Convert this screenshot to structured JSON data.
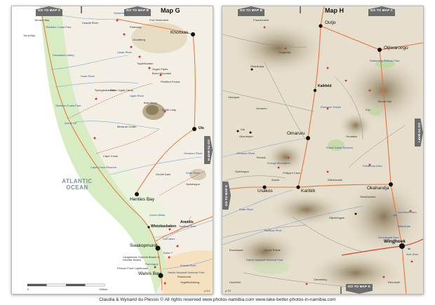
{
  "footer_text": "Claudia & Wynand du Plessis  ©  All rights reserved   www.photos-namibia.com   www.take-better-photos-in-namibia.com",
  "map_g": {
    "title": "Map G",
    "nav": {
      "top_left": "GO TO MAP A",
      "top_right": "GO TO MAP B",
      "right": "GO TO MAP H"
    },
    "ocean": "ATLANTIC OCEAN",
    "scale": {
      "start": "0",
      "end": "100km"
    },
    "page_number": "p.14",
    "labels_blue": [
      "Sesfontein",
      "Skeleton Coast Park",
      "Desolation Valley",
      "Huab River",
      "Uniab River",
      "Skeleton Coast Park",
      "Ugab River",
      "Cape Cross Reserve",
      "Dorob NP",
      "Omaruru River",
      "Khan River",
      "Swakop River",
      "Kuiseb River",
      "Namib Naukluft National Park",
      "Lichen fields",
      "Salt lakes",
      "Flamingos"
    ],
    "labels_black": [
      "Torra Bay",
      "Terrace Bay",
      "Springbokwasser",
      "Palmwag",
      "Grootberg",
      "Fort Sesfontein",
      "Hoanib River",
      "Rhino Ugab Camp",
      "Brandberg",
      "White Lady",
      "Messum Crater",
      "Uis",
      "Cape Cross",
      "Omdel Dam",
      "Spitzkoppe",
      "Langstrand, Dolphin Beach & Afrodite Beach",
      "Pelican Point Lighthouse",
      "Dune 7",
      "Vogelfederberg",
      "Rossmund"
    ],
    "towns": [
      "Khorixas",
      "Henties Bay",
      "Swakopmund",
      "Walvis Bay",
      "Wlotzkasbaken",
      "Arandis",
      "Twyfelfontein",
      "Organ Pipes",
      "Burnt Mountain",
      "Petrified Forest"
    ]
  },
  "map_h": {
    "title": "Map H",
    "nav": {
      "top_left": "GO TO MAP B",
      "top_right": "GO TO MAP C",
      "left": "GO TO MAP G",
      "right": "GO TO MAP I",
      "bottom": "GO TO MAP K"
    },
    "page_number": "p.15",
    "towns": [
      "Outjo",
      "Otjiwarongo",
      "Kalkfeld",
      "Omaruru",
      "Karibib",
      "Usakos",
      "Okahandja",
      "Windhoek"
    ],
    "labels_blue": [
      "Waterberg Plateau Park",
      "Etjo",
      "Omaruru River",
      "Khan River",
      "Swakop River",
      "Von Bach Dam",
      "Goreangab Dam",
      "Avis Dam",
      "Erongo Mountains",
      "Dinosaur Tracks",
      "Erindi Game Reserve",
      "Naankuse",
      "Namib Naukluft National Park",
      "Friedenau Dam"
    ],
    "labels_black": [
      "Franzfontein",
      "Vingerklip",
      "Okaukuejo",
      "Okongue",
      "Omaruru",
      "Uis",
      "Okombahe",
      "Tubusis",
      "Spitzkoppe",
      "Philipp's Cave",
      "Ameib",
      "Wilhelmstal",
      "Otjimbingwe",
      "Groot Tinkas",
      "Bosluispas",
      "Gamsberg",
      "Rehoboth",
      "Hochfeld",
      "Mount Etjo",
      "Omatako",
      "Steinhausen"
    ]
  }
}
